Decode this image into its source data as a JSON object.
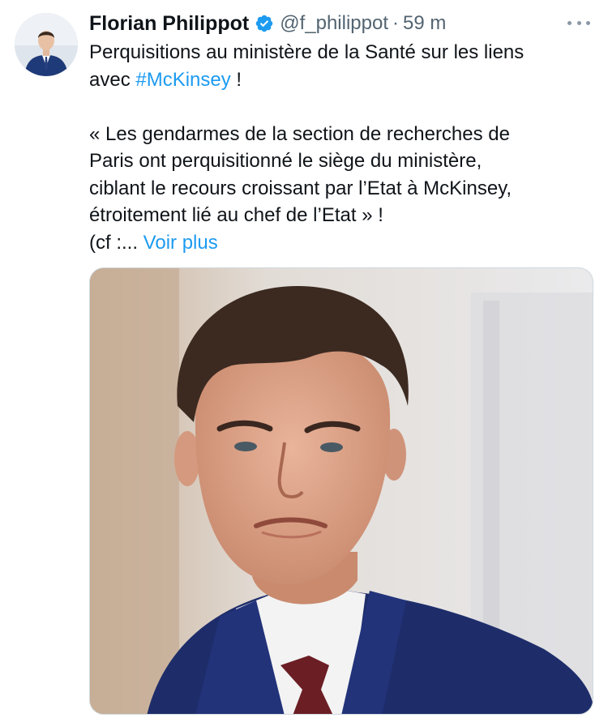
{
  "tweet": {
    "author": {
      "display_name": "Florian Philippot",
      "handle": "@f_philippot",
      "verified_icon": "verified-badge-icon",
      "avatar_icon": "avatar"
    },
    "separator": "·",
    "time": "59 m",
    "more_icon": "more-options-icon",
    "text": {
      "line1": "Perquisitions au ministère de la Santé sur les liens",
      "line2_prefix": "avec ",
      "hashtag": "#McKinsey",
      "line2_suffix": " !",
      "quote1": "« Les gendarmes de la section de recherches de",
      "quote2": "Paris ont perquisitionné le siège du ministère,",
      "quote3": "ciblant le recours croissant par l’Etat à McKinsey,",
      "quote4": "étroitement lié au chef de l’Etat » !",
      "truncated": "(cf :...",
      "show_more": "Voir plus"
    },
    "media": {
      "type": "photo"
    }
  },
  "colors": {
    "text": "#0f1419",
    "secondary": "#536471",
    "link": "#1d9bf0",
    "verified": "#1d9bf0"
  }
}
